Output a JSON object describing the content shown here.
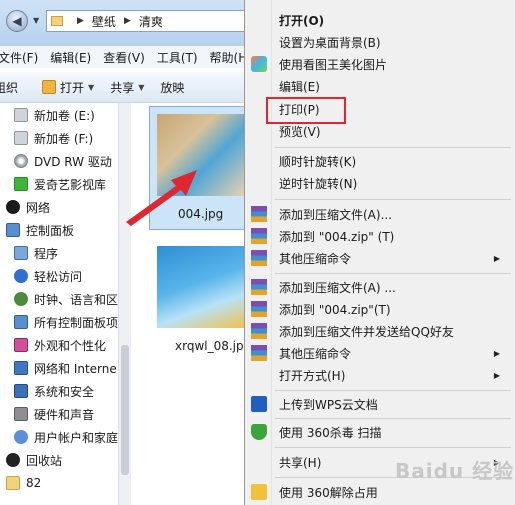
{
  "address": {
    "crumbs": [
      "壁纸",
      "清爽"
    ]
  },
  "menubar": [
    "文件(F)",
    "编辑(E)",
    "查看(V)",
    "工具(T)",
    "帮助(H)"
  ],
  "toolbar": {
    "organize": "组织",
    "open": "打开",
    "share": "共享",
    "slideshow": "放映"
  },
  "nav": [
    {
      "label": "新加卷 (E:)",
      "icon": "drive-icon"
    },
    {
      "label": "新加卷 (F:)",
      "icon": "drive-icon"
    },
    {
      "label": "DVD RW 驱动",
      "icon": "dvd-icon"
    },
    {
      "label": "爱奇艺影视库",
      "icon": "iqiyi-icon"
    },
    {
      "label": "网络",
      "icon": "network-icon"
    },
    {
      "label": "控制面板",
      "icon": "control-panel-icon"
    },
    {
      "label": "程序",
      "icon": "programs-icon"
    },
    {
      "label": "轻松访问",
      "icon": "accessibility-icon"
    },
    {
      "label": "时钟、语言和区",
      "icon": "clock-icon"
    },
    {
      "label": "所有控制面板项",
      "icon": "control-panel-icon"
    },
    {
      "label": "外观和个性化",
      "icon": "appearance-icon"
    },
    {
      "label": "网络和 Interne",
      "icon": "network-internet-icon"
    },
    {
      "label": "系统和安全",
      "icon": "security-icon"
    },
    {
      "label": "硬件和声音",
      "icon": "hardware-icon"
    },
    {
      "label": "用户帐户和家庭",
      "icon": "users-icon"
    },
    {
      "label": "回收站",
      "icon": "recycle-bin-icon"
    },
    {
      "label": "82",
      "icon": "folder-icon"
    }
  ],
  "files": [
    {
      "name": "004.jpg",
      "selected": true
    },
    {
      "name": "xrqwl_08.jpg",
      "selected": false
    }
  ],
  "context_menu": {
    "group1": [
      "打开(O)",
      "设置为桌面背景(B)",
      "使用看图王美化图片",
      "编辑(E)",
      "打印(P)",
      "预览(V)"
    ],
    "group2": [
      "顺时针旋转(K)",
      "逆时针旋转(N)"
    ],
    "group3": [
      "添加到压缩文件(A)...",
      "添加到 \"004.zip\" (T)",
      "其他压缩命令"
    ],
    "group4": [
      "添加到压缩文件(A) ...",
      "添加到 \"004.zip\"(T)",
      "添加到压缩文件并发送给QQ好友",
      "其他压缩命令",
      "打开方式(H)"
    ],
    "group5": [
      "上传到WPS云文档"
    ],
    "group6": [
      "使用 360杀毒 扫描"
    ],
    "group7": [
      "共享(H)"
    ],
    "group8": [
      "使用 360解除占用"
    ]
  },
  "watermark": "Baidu 经验",
  "colors": {
    "highlight": "#e0262f",
    "selection": "#cce4f7",
    "arrow": "#e0262f"
  }
}
